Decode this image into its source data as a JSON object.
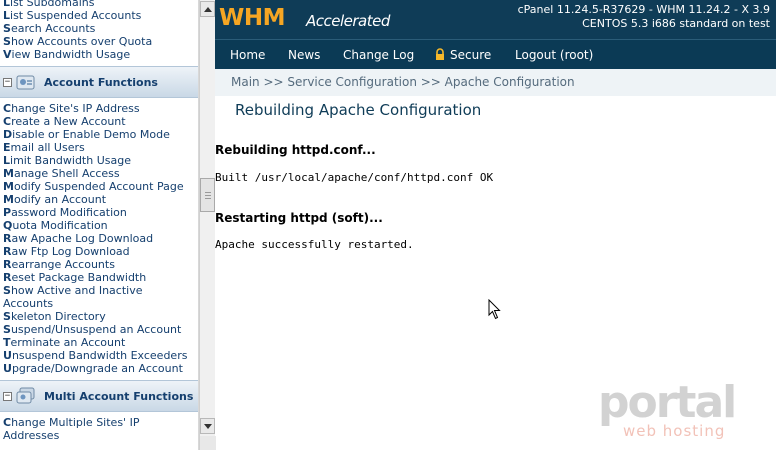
{
  "sidebar": {
    "top_items": [
      {
        "first": "L",
        "rest": "ist Subdomains"
      },
      {
        "first": "L",
        "rest": "ist Suspended Accounts"
      },
      {
        "first": "S",
        "rest": "earch Accounts"
      },
      {
        "first": "S",
        "rest": "how Accounts over Quota"
      },
      {
        "first": "V",
        "rest": "iew Bandwidth Usage"
      }
    ],
    "account_functions": {
      "title": "Account Functions",
      "toggle": "−",
      "items": [
        {
          "first": "C",
          "rest": "hange Site's IP Address"
        },
        {
          "first": "C",
          "rest": "reate a New Account"
        },
        {
          "first": "D",
          "rest": "isable or Enable Demo Mode"
        },
        {
          "first": "E",
          "rest": "mail all Users"
        },
        {
          "first": "L",
          "rest": "imit Bandwidth Usage"
        },
        {
          "first": "M",
          "rest": "anage Shell Access"
        },
        {
          "first": "M",
          "rest": "odify Suspended Account Page"
        },
        {
          "first": "M",
          "rest": "odify an Account"
        },
        {
          "first": "P",
          "rest": "assword Modification"
        },
        {
          "first": "Q",
          "rest": "uota Modification"
        },
        {
          "first": "R",
          "rest": "aw Apache Log Download"
        },
        {
          "first": "R",
          "rest": "aw Ftp Log Download"
        },
        {
          "first": "R",
          "rest": "earrange Accounts"
        },
        {
          "first": "R",
          "rest": "eset Package Bandwidth"
        },
        {
          "first": "S",
          "rest": "how Active and Inactive"
        },
        {
          "first": "",
          "rest": "Accounts"
        },
        {
          "first": "S",
          "rest": "keleton Directory"
        },
        {
          "first": "S",
          "rest": "uspend/Unsuspend an Account"
        },
        {
          "first": "T",
          "rest": "erminate an Account"
        },
        {
          "first": "U",
          "rest": "nsuspend Bandwidth Exceeders"
        },
        {
          "first": "U",
          "rest": "pgrade/Downgrade an Account"
        }
      ]
    },
    "multi_account_functions": {
      "title": "Multi Account Functions",
      "toggle": "−",
      "items": [
        {
          "first": "C",
          "rest": "hange Multiple Sites' IP"
        },
        {
          "first": "",
          "rest": "Addresses"
        }
      ]
    }
  },
  "header": {
    "logo_whm": "WHM",
    "logo_accelerated": "Accelerated",
    "version_line1": "cPanel 11.24.5-R37629 - WHM 11.24.2 - X 3.9",
    "version_line2": "CENTOS 5.3 i686 standard on test"
  },
  "nav": {
    "home": "Home",
    "news": "News",
    "changelog": "Change Log",
    "secure": "Secure",
    "logout": "Logout (root)"
  },
  "breadcrumb": "Main >> Service Configuration >> Apache Configuration",
  "main": {
    "title": "Rebuilding Apache Configuration",
    "rebuild_heading": "Rebuilding httpd.conf...",
    "rebuild_output": "Built /usr/local/apache/conf/httpd.conf OK",
    "restart_heading": "Restarting httpd (soft)...",
    "restart_output": "Apache successfully restarted."
  },
  "watermark": {
    "brand": "portal",
    "tagline": "web hosting"
  },
  "colors": {
    "header_bg": "#0f3c57",
    "logo_orange": "#f6a623",
    "link_blue": "#153f6e"
  }
}
